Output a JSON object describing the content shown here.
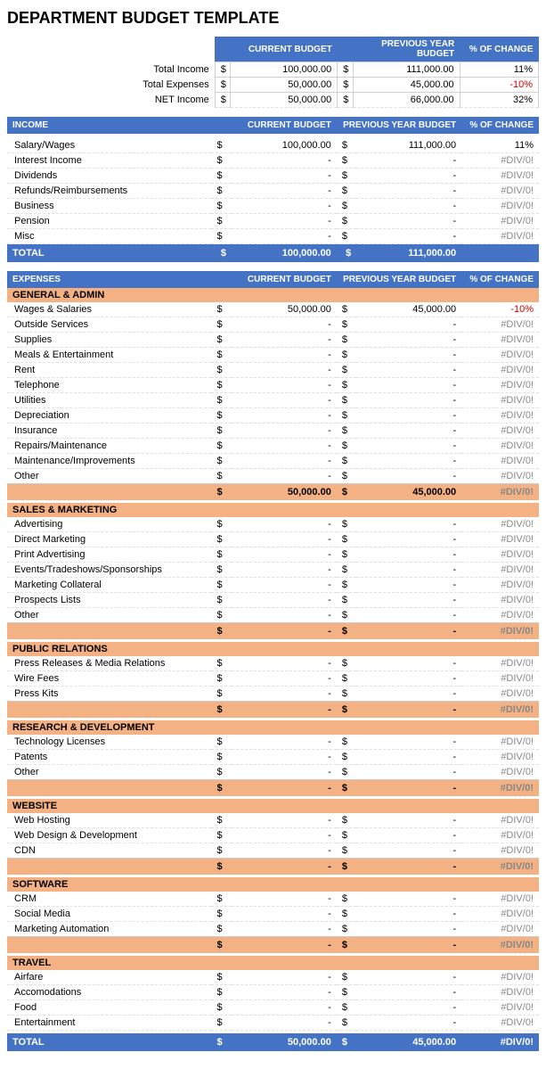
{
  "title": "DEPARTMENT BUDGET TEMPLATE",
  "summary": {
    "headers": {
      "current": "CURRENT BUDGET",
      "previous": "PREVIOUS YEAR BUDGET",
      "pct": "% OF CHANGE"
    },
    "rows": [
      {
        "label": "Total Income",
        "curr_d": "$",
        "curr": "100,000.00",
        "prev_d": "$",
        "prev": "111,000.00",
        "pct": "11%",
        "pct_neg": false
      },
      {
        "label": "Total Expenses",
        "curr_d": "$",
        "curr": "50,000.00",
        "prev_d": "$",
        "prev": "45,000.00",
        "pct": "-10%",
        "pct_neg": true
      },
      {
        "label": "NET Income",
        "curr_d": "$",
        "curr": "50,000.00",
        "prev_d": "$",
        "prev": "66,000.00",
        "pct": "32%",
        "pct_neg": false
      }
    ]
  },
  "income": {
    "header": {
      "label": "INCOME",
      "current": "CURRENT BUDGET",
      "previous": "PREVIOUS YEAR BUDGET",
      "pct": "% OF CHANGE"
    },
    "rows": [
      {
        "type": "data",
        "label": "Salary/Wages",
        "curr_d": "$",
        "curr": "100,000.00",
        "prev_d": "$",
        "prev": "111,000.00",
        "pct": "11%",
        "pct_neg": false
      },
      {
        "type": "data",
        "label": "Interest Income",
        "curr_d": "$",
        "curr": "-",
        "prev_d": "$",
        "prev": "-",
        "pct": "#DIV/0!",
        "pct_neg": false
      },
      {
        "type": "data",
        "label": "Dividends",
        "curr_d": "$",
        "curr": "-",
        "prev_d": "$",
        "prev": "-",
        "pct": "#DIV/0!",
        "pct_neg": false
      },
      {
        "type": "data",
        "label": "Refunds/Reimbursements",
        "curr_d": "$",
        "curr": "-",
        "prev_d": "$",
        "prev": "-",
        "pct": "#DIV/0!",
        "pct_neg": false
      },
      {
        "type": "data",
        "label": "Business",
        "curr_d": "$",
        "curr": "-",
        "prev_d": "$",
        "prev": "-",
        "pct": "#DIV/0!",
        "pct_neg": false
      },
      {
        "type": "data",
        "label": "Pension",
        "curr_d": "$",
        "curr": "-",
        "prev_d": "$",
        "prev": "-",
        "pct": "#DIV/0!",
        "pct_neg": false
      },
      {
        "type": "data",
        "label": "Misc",
        "curr_d": "$",
        "curr": "-",
        "prev_d": "$",
        "prev": "-",
        "pct": "#DIV/0!",
        "pct_neg": false
      },
      {
        "type": "total",
        "label": "TOTAL",
        "curr_d": "$",
        "curr": "100,000.00",
        "prev_d": "$",
        "prev": "111,000.00",
        "pct": ""
      }
    ]
  },
  "expenses": {
    "header": {
      "label": "EXPENSES",
      "current": "CURRENT BUDGET",
      "previous": "PREVIOUS YEAR BUDGET",
      "pct": "% OF CHANGE"
    },
    "sections": [
      {
        "name": "GENERAL & ADMIN",
        "rows": [
          {
            "label": "Wages & Salaries",
            "curr": "50,000.00",
            "prev": "45,000.00",
            "pct": "-10%",
            "pct_neg": true
          },
          {
            "label": "Outside Services",
            "curr": "-",
            "prev": "-",
            "pct": "#DIV/0!",
            "pct_neg": false
          },
          {
            "label": "Supplies",
            "curr": "-",
            "prev": "-",
            "pct": "#DIV/0!",
            "pct_neg": false
          },
          {
            "label": "Meals & Entertainment",
            "curr": "-",
            "prev": "-",
            "pct": "#DIV/0!",
            "pct_neg": false
          },
          {
            "label": "Rent",
            "curr": "-",
            "prev": "-",
            "pct": "#DIV/0!",
            "pct_neg": false
          },
          {
            "label": "Telephone",
            "curr": "-",
            "prev": "-",
            "pct": "#DIV/0!",
            "pct_neg": false
          },
          {
            "label": "Utilities",
            "curr": "-",
            "prev": "-",
            "pct": "#DIV/0!",
            "pct_neg": false
          },
          {
            "label": "Depreciation",
            "curr": "-",
            "prev": "-",
            "pct": "#DIV/0!",
            "pct_neg": false
          },
          {
            "label": "Insurance",
            "curr": "-",
            "prev": "-",
            "pct": "#DIV/0!",
            "pct_neg": false
          },
          {
            "label": "Repairs/Maintenance",
            "curr": "-",
            "prev": "-",
            "pct": "#DIV/0!",
            "pct_neg": false
          },
          {
            "label": "Maintenance/Improvements",
            "curr": "-",
            "prev": "-",
            "pct": "#DIV/0!",
            "pct_neg": false
          },
          {
            "label": "Other",
            "curr": "-",
            "prev": "-",
            "pct": "#DIV/0!",
            "pct_neg": false
          }
        ],
        "total": {
          "curr": "50,000.00",
          "prev": "45,000.00",
          "pct": "#DIV/0!"
        }
      },
      {
        "name": "SALES & MARKETING",
        "rows": [
          {
            "label": "Advertising",
            "curr": "-",
            "prev": "-",
            "pct": "#DIV/0!",
            "pct_neg": false
          },
          {
            "label": "Direct Marketing",
            "curr": "-",
            "prev": "-",
            "pct": "#DIV/0!",
            "pct_neg": false
          },
          {
            "label": "Print Advertising",
            "curr": "-",
            "prev": "-",
            "pct": "#DIV/0!",
            "pct_neg": false
          },
          {
            "label": "Events/Tradeshows/Sponsorships",
            "curr": "-",
            "prev": "-",
            "pct": "#DIV/0!",
            "pct_neg": false
          },
          {
            "label": "Marketing Collateral",
            "curr": "-",
            "prev": "-",
            "pct": "#DIV/0!",
            "pct_neg": false
          },
          {
            "label": "Prospects Lists",
            "curr": "-",
            "prev": "-",
            "pct": "#DIV/0!",
            "pct_neg": false
          },
          {
            "label": "Other",
            "curr": "-",
            "prev": "-",
            "pct": "#DIV/0!",
            "pct_neg": false
          }
        ],
        "total": {
          "curr": "-",
          "prev": "-",
          "pct": "#DIV/0!"
        }
      },
      {
        "name": "PUBLIC RELATIONS",
        "rows": [
          {
            "label": "Press Releases & Media Relations",
            "curr": "-",
            "prev": "-",
            "pct": "#DIV/0!",
            "pct_neg": false
          },
          {
            "label": "Wire Fees",
            "curr": "-",
            "prev": "-",
            "pct": "#DIV/0!",
            "pct_neg": false
          },
          {
            "label": "Press Kits",
            "curr": "-",
            "prev": "-",
            "pct": "#DIV/0!",
            "pct_neg": false
          }
        ],
        "total": {
          "curr": "-",
          "prev": "-",
          "pct": "#DIV/0!"
        }
      },
      {
        "name": "RESEARCH & DEVELOPMENT",
        "rows": [
          {
            "label": "Technology Licenses",
            "curr": "-",
            "prev": "-",
            "pct": "#DIV/0!",
            "pct_neg": false
          },
          {
            "label": "Patents",
            "curr": "-",
            "prev": "-",
            "pct": "#DIV/0!",
            "pct_neg": false
          },
          {
            "label": "Other",
            "curr": "-",
            "prev": "-",
            "pct": "#DIV/0!",
            "pct_neg": false
          }
        ],
        "total": {
          "curr": "-",
          "prev": "-",
          "pct": "#DIV/0!"
        }
      },
      {
        "name": "WEBSITE",
        "rows": [
          {
            "label": "Web Hosting",
            "curr": "-",
            "prev": "-",
            "pct": "#DIV/0!",
            "pct_neg": false
          },
          {
            "label": "Web Design & Development",
            "curr": "-",
            "prev": "-",
            "pct": "#DIV/0!",
            "pct_neg": false
          },
          {
            "label": "CDN",
            "curr": "-",
            "prev": "-",
            "pct": "#DIV/0!",
            "pct_neg": false
          }
        ],
        "total": {
          "curr": "-",
          "prev": "-",
          "pct": "#DIV/0!"
        }
      },
      {
        "name": "SOFTWARE",
        "rows": [
          {
            "label": "CRM",
            "curr": "-",
            "prev": "-",
            "pct": "#DIV/0!",
            "pct_neg": false
          },
          {
            "label": "Social Media",
            "curr": "-",
            "prev": "-",
            "pct": "#DIV/0!",
            "pct_neg": false
          },
          {
            "label": "Marketing Automation",
            "curr": "-",
            "prev": "-",
            "pct": "#DIV/0!",
            "pct_neg": false
          }
        ],
        "total": {
          "curr": "-",
          "prev": "-",
          "pct": "#DIV/0!"
        }
      },
      {
        "name": "TRAVEL",
        "rows": [
          {
            "label": "Airfare",
            "curr": "-",
            "prev": "-",
            "pct": "#DIV/0!",
            "pct_neg": false
          },
          {
            "label": "Accomodations",
            "curr": "-",
            "prev": "-",
            "pct": "#DIV/0!",
            "pct_neg": false
          },
          {
            "label": "Food",
            "curr": "-",
            "prev": "-",
            "pct": "#DIV/0!",
            "pct_neg": false
          },
          {
            "label": "Entertainment",
            "curr": "-",
            "prev": "-",
            "pct": "#DIV/0!",
            "pct_neg": false
          }
        ],
        "total": null
      }
    ],
    "grand_total": {
      "curr": "50,000.00",
      "prev": "45,000.00",
      "pct": "#DIV/0!"
    }
  }
}
